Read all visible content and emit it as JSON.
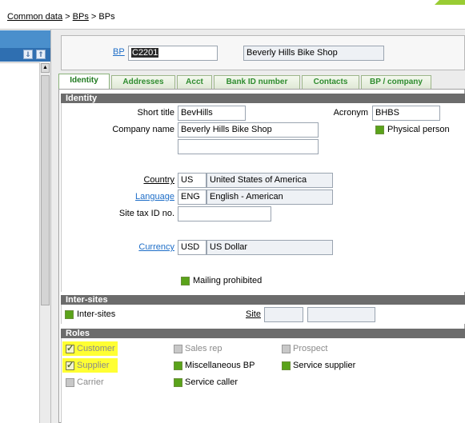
{
  "breadcrumb": {
    "items": [
      "Common data",
      "BPs",
      "BPs"
    ],
    "sep": ">"
  },
  "colors": {
    "accent_green": "#5aa31a",
    "highlight": "#ffff33",
    "link": "#1e6ec8",
    "section_header": "#6c6c6c"
  },
  "left_pane": {
    "toolbar_icons": [
      "scroll-down-icon",
      "scroll-up-icon"
    ]
  },
  "bp": {
    "label": "BP",
    "code": "C2201",
    "name": "Beverly Hills Bike Shop"
  },
  "tabs": [
    "Identity",
    "Addresses",
    "Acct",
    "Bank ID number",
    "Contacts",
    "BP / company"
  ],
  "active_tab": "Identity",
  "identity": {
    "title": "Identity",
    "short_title_label": "Short title",
    "short_title": "BevHills",
    "company_name_label": "Company name",
    "company_name": "Beverly Hills Bike Shop",
    "company_name_2": "",
    "acronym_label": "Acronym",
    "acronym": "BHBS",
    "physical_person_label": "Physical person",
    "country_label": "Country",
    "country_code": "US",
    "country_name": "United States of America",
    "language_label": "Language",
    "language_code": "ENG",
    "language_name": "English - American",
    "site_tax_label": "Site tax ID no.",
    "site_tax": "",
    "currency_label": "Currency",
    "currency_code": "USD",
    "currency_name": "US Dollar",
    "mailing_prohibited_label": "Mailing prohibited"
  },
  "inter_sites": {
    "title": "Inter-sites",
    "inter_sites_label": "Inter-sites",
    "site_label": "Site",
    "site_code": "",
    "site_name": ""
  },
  "roles": {
    "title": "Roles",
    "customer": "Customer",
    "supplier": "Supplier",
    "carrier": "Carrier",
    "sales_rep": "Sales rep",
    "misc_bp": "Miscellaneous BP",
    "service_caller": "Service caller",
    "prospect": "Prospect",
    "service_supplier": "Service supplier"
  }
}
